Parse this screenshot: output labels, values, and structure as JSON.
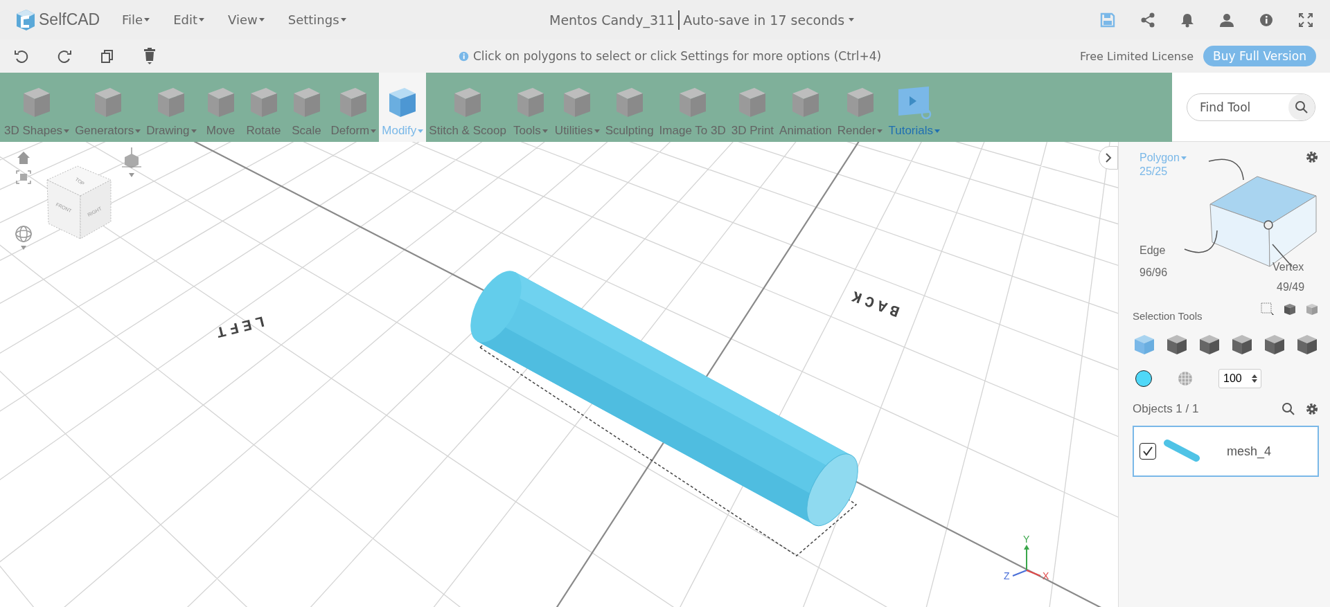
{
  "app": {
    "name": "SelfCAD"
  },
  "menu": [
    {
      "label": "File"
    },
    {
      "label": "Edit"
    },
    {
      "label": "View"
    },
    {
      "label": "Settings"
    }
  ],
  "document": {
    "title": "Mentos Candy_311",
    "autosave": "Auto-save in 17 seconds"
  },
  "hint": "Click on polygons to select or click Settings for more options (Ctrl+4)",
  "license": "Free Limited License",
  "buy_button": "Buy Full Version",
  "tools": [
    {
      "label": "3D Shapes",
      "dropdown": true,
      "selected": false,
      "kind": "tool"
    },
    {
      "label": "Generators",
      "dropdown": true,
      "selected": false,
      "kind": "tool"
    },
    {
      "label": "Drawing",
      "dropdown": true,
      "selected": false,
      "kind": "tool"
    },
    {
      "label": "Move",
      "dropdown": false,
      "selected": false,
      "kind": "tool"
    },
    {
      "label": "Rotate",
      "dropdown": false,
      "selected": false,
      "kind": "tool"
    },
    {
      "label": "Scale",
      "dropdown": false,
      "selected": false,
      "kind": "tool"
    },
    {
      "label": "Deform",
      "dropdown": true,
      "selected": false,
      "kind": "tool"
    },
    {
      "label": "Modify",
      "dropdown": true,
      "selected": true,
      "kind": "tool"
    },
    {
      "label": "Stitch & Scoop",
      "dropdown": false,
      "selected": false,
      "kind": "tool"
    },
    {
      "label": "Tools",
      "dropdown": true,
      "selected": false,
      "kind": "tool"
    },
    {
      "label": "Utilities",
      "dropdown": true,
      "selected": false,
      "kind": "tool"
    },
    {
      "label": "Sculpting",
      "dropdown": false,
      "selected": false,
      "kind": "tool"
    },
    {
      "label": "Image To 3D",
      "dropdown": false,
      "selected": false,
      "kind": "tool"
    },
    {
      "label": "3D Print",
      "dropdown": false,
      "selected": false,
      "kind": "tool"
    },
    {
      "label": "Animation",
      "dropdown": false,
      "selected": false,
      "kind": "tool"
    },
    {
      "label": "Render",
      "dropdown": true,
      "selected": false,
      "kind": "tool"
    },
    {
      "label": "Tutorials",
      "dropdown": true,
      "selected": false,
      "kind": "link"
    }
  ],
  "search": {
    "placeholder": "Find Tool"
  },
  "viewport": {
    "labels": [
      "LEFT",
      "BACK"
    ],
    "view_cube": [
      "TOP",
      "FRONT",
      "RIGHT"
    ],
    "axes": [
      "Y",
      "Z",
      "X"
    ]
  },
  "panel": {
    "mode": "Polygon",
    "polygon_count": "25/25",
    "edge_label": "Edge",
    "edge_count": "96/96",
    "vertex_label": "Vertex",
    "vertex_count": "49/49",
    "selection_tools": "Selection Tools",
    "selection_modes": [
      {
        "selected": true
      },
      {
        "selected": false
      },
      {
        "selected": false
      },
      {
        "selected": false
      },
      {
        "selected": false
      },
      {
        "selected": false
      }
    ],
    "opacity": "100",
    "objects_label": "Objects 1 / 1",
    "objects": [
      {
        "name": "mesh_4",
        "checked": true,
        "selected": true
      }
    ]
  }
}
